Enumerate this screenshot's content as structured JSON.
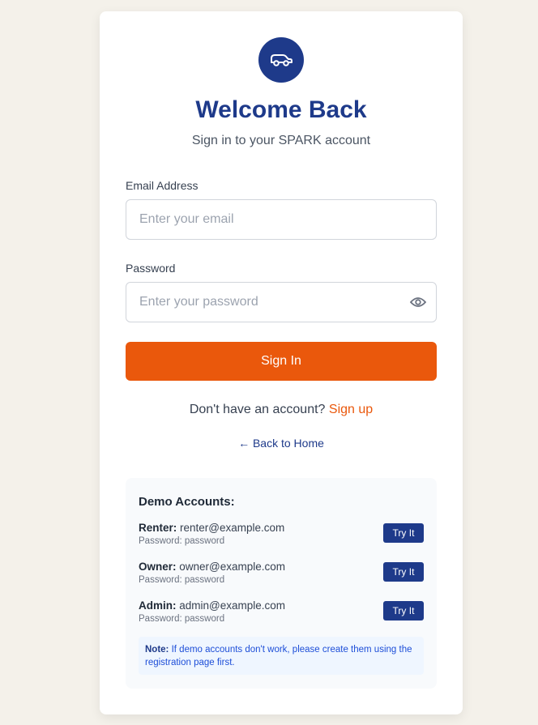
{
  "header": {
    "logo_icon": "car-icon",
    "title": "Welcome Back",
    "subtitle": "Sign in to your SPARK account"
  },
  "form": {
    "email_label": "Email Address",
    "email_placeholder": "Enter your email",
    "email_value": "",
    "password_label": "Password",
    "password_placeholder": "Enter your password",
    "password_value": "",
    "password_toggle_icon": "eye-icon",
    "submit_label": "Sign In"
  },
  "links": {
    "signup_prompt": "Don't have an account?",
    "signup_label": "Sign up",
    "back_label": "← Back to Home"
  },
  "demo": {
    "title": "Demo Accounts:",
    "accounts": [
      {
        "role": "Renter:",
        "email": "renter@example.com",
        "password_text": "Password: password",
        "button": "Try It"
      },
      {
        "role": "Owner:",
        "email": "owner@example.com",
        "password_text": "Password: password",
        "button": "Try It"
      },
      {
        "role": "Admin:",
        "email": "admin@example.com",
        "password_text": "Password: password",
        "button": "Try It"
      }
    ],
    "note_label": "Note:",
    "note_text": "If demo accounts don't work, please create them using the registration page first."
  },
  "colors": {
    "primary": "#1e3a8a",
    "accent": "#ea580c",
    "background": "#f4f1ea"
  }
}
